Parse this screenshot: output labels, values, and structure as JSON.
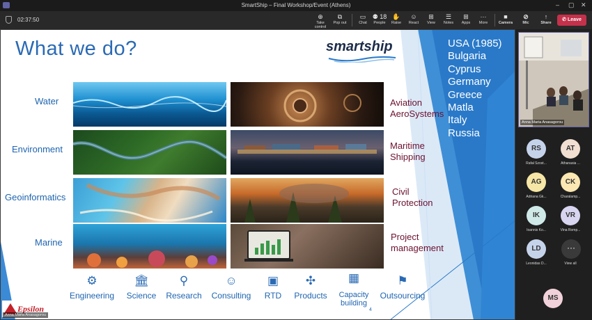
{
  "window": {
    "title": "SmartShip – Final Workshop/Event (Athens)"
  },
  "toolbar": {
    "timer": "02:37:50",
    "buttons": [
      {
        "label": "Take control",
        "icon": "take-control-icon",
        "glyph": "⊕"
      },
      {
        "label": "Pop out",
        "icon": "pop-out-icon",
        "glyph": "⧉"
      },
      {
        "label": "Chat",
        "icon": "chat-icon",
        "glyph": "▭"
      },
      {
        "label": "People",
        "icon": "people-icon",
        "glyph": "⚉ 18"
      },
      {
        "label": "Raise",
        "icon": "raise-hand-icon",
        "glyph": "✋"
      },
      {
        "label": "React",
        "icon": "react-icon",
        "glyph": "☺"
      },
      {
        "label": "View",
        "icon": "view-icon",
        "glyph": "⊞"
      },
      {
        "label": "Notes",
        "icon": "notes-icon",
        "glyph": "☰"
      },
      {
        "label": "Apps",
        "icon": "apps-icon",
        "glyph": "⊞"
      },
      {
        "label": "More",
        "icon": "more-icon",
        "glyph": "···"
      },
      {
        "label": "Camera",
        "icon": "camera-icon",
        "glyph": "■"
      },
      {
        "label": "Mic",
        "icon": "mic-off-icon",
        "glyph": "⊘"
      },
      {
        "label": "Share",
        "icon": "share-icon",
        "glyph": "↑"
      }
    ],
    "leave_label": "Leave"
  },
  "slide": {
    "title": "What we do?",
    "logo_text": "smartship",
    "countries": [
      "USA (1985)",
      "Bulgaria",
      "Cyprus",
      "Germany",
      "Greece",
      "Matla",
      "Italy",
      "Russia"
    ],
    "left_labels": [
      "Water",
      "Environment",
      "Geoinformatics",
      "Marine"
    ],
    "right_labels": [
      {
        "line1": "Aviation",
        "line2": "AeroSystems"
      },
      {
        "line1": "Maritime",
        "line2": "Shipping"
      },
      {
        "line1": "Civil",
        "line2": "Protection"
      },
      {
        "line1": "Project",
        "line2": "management"
      }
    ],
    "services": [
      {
        "label": "Engineering",
        "icon": "engineering-icon"
      },
      {
        "label": "Science",
        "icon": "science-icon"
      },
      {
        "label": "Research",
        "icon": "research-icon"
      },
      {
        "label": "Consulting",
        "icon": "consulting-icon"
      },
      {
        "label": "RTD",
        "icon": "rtd-icon"
      },
      {
        "label": "Products",
        "icon": "products-icon"
      },
      {
        "label": "Capacity building",
        "icon": "capacity-building-icon"
      },
      {
        "label": "Outsourcing",
        "icon": "outsourcing-icon"
      }
    ],
    "page_number": "4",
    "footer_logo": "Epsilon",
    "presenter_chip": "Anna Maria Anasagorou"
  },
  "participants": {
    "video_name": "Anna Maria Anasagorou",
    "people": [
      {
        "initials": "RS",
        "name": "Rafał Szost...",
        "color": "#c5d3ea"
      },
      {
        "initials": "AT",
        "name": "Athanasia ...",
        "color": "#f1dfd2"
      },
      {
        "initials": "AG",
        "name": "Adriana Gk...",
        "color": "#f6e7a6"
      },
      {
        "initials": "CK",
        "name": "Charalamp...",
        "color": "#fbe8b2"
      },
      {
        "initials": "IK",
        "name": "Ioannis Ko...",
        "color": "#cfe9e8"
      },
      {
        "initials": "VR",
        "name": "Vina Romp...",
        "color": "#d8d5f0"
      },
      {
        "initials": "LD",
        "name": "Leonidas D...",
        "color": "#c5d3ea"
      },
      {
        "initials": "MS",
        "name": "",
        "color": "#f2d2da"
      }
    ],
    "view_all_label": "View all"
  }
}
